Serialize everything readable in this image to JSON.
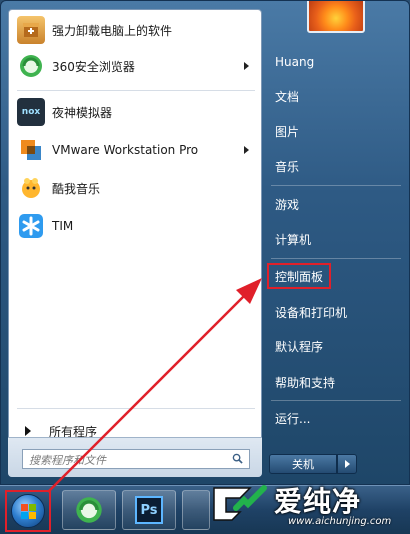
{
  "programs": [
    {
      "label": "强力卸载电脑上的软件",
      "icon": "uninstaller-icon",
      "submenu": false
    },
    {
      "label": "360安全浏览器",
      "icon": "360-browser-icon",
      "submenu": true
    },
    {
      "label": "夜神模拟器",
      "icon": "nox-icon",
      "icon_text": "nox",
      "submenu": false
    },
    {
      "label": "VMware Workstation Pro",
      "icon": "vmware-icon",
      "submenu": true
    },
    {
      "label": "酷我音乐",
      "icon": "kuwo-music-icon",
      "submenu": false
    },
    {
      "label": "TIM",
      "icon": "tim-icon",
      "submenu": false
    }
  ],
  "all_programs_label": "所有程序",
  "search": {
    "placeholder": "搜索程序和文件"
  },
  "right_items": [
    {
      "label": "Huang"
    },
    {
      "label": "文档"
    },
    {
      "label": "图片"
    },
    {
      "label": "音乐"
    },
    {
      "label": "游戏"
    },
    {
      "label": "计算机"
    },
    {
      "label": "控制面板",
      "highlighted": true
    },
    {
      "label": "设备和打印机"
    },
    {
      "label": "默认程序"
    },
    {
      "label": "帮助和支持"
    },
    {
      "label": "运行..."
    }
  ],
  "shutdown_label": "关机",
  "taskbar": {
    "items": [
      {
        "name": "start-button"
      },
      {
        "name": "360-browser-icon"
      },
      {
        "name": "photoshop-icon",
        "text": "Ps"
      }
    ]
  },
  "watermark": {
    "text": "爱纯净",
    "url": "www.aichunjing.com"
  },
  "colors": {
    "highlight_border": "#e0202a",
    "menu_blue": "#2e5a84"
  }
}
